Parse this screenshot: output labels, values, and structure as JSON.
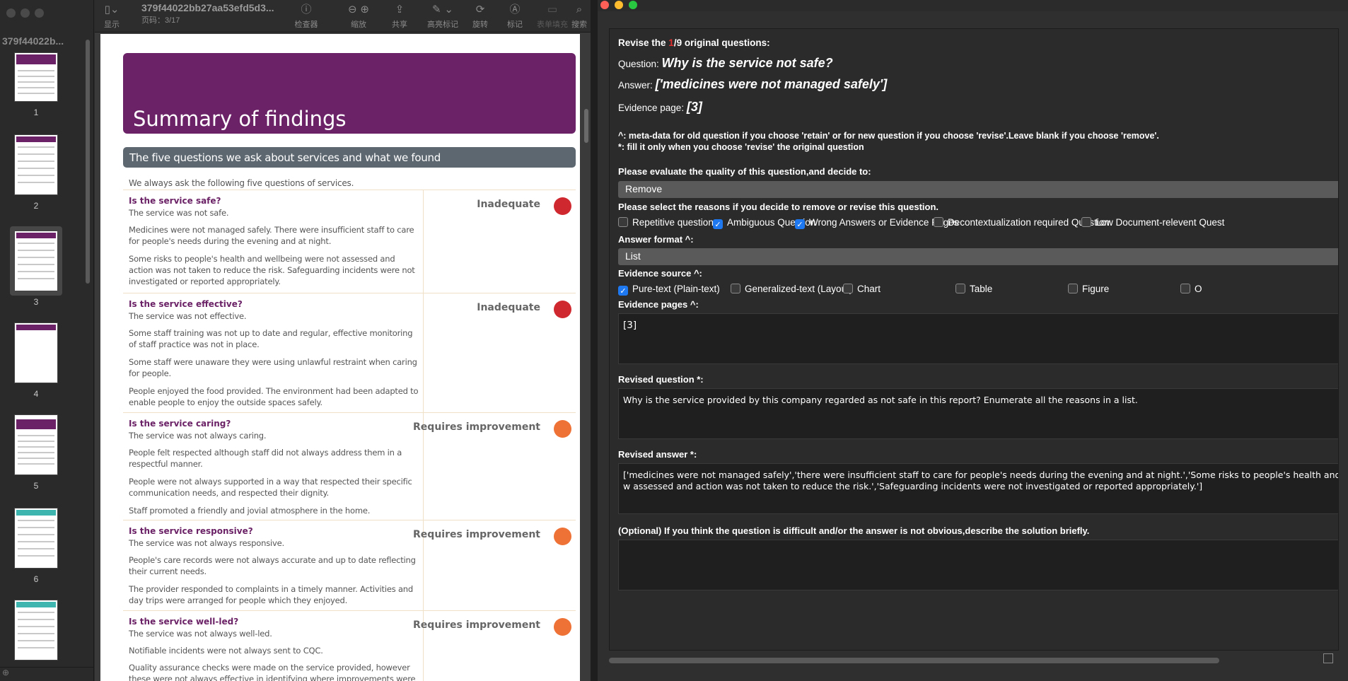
{
  "viewer": {
    "doc_title": "379f44022bb27aa53efd5d3...",
    "page_indicator": "页码：3/17",
    "sidebar_name": "379f44022b...",
    "toolbar": {
      "display": "显示",
      "inspector": "检查器",
      "zoom": "缩放",
      "share": "共享",
      "highlight": "高亮标记",
      "rotate": "旋转",
      "markup": "标记",
      "form_fill": "表单填充",
      "search": "搜索"
    },
    "thumbnails": [
      "1",
      "2",
      "3",
      "4",
      "5",
      "6"
    ],
    "selected_page": "3"
  },
  "pdf": {
    "banner_title": "Summary of findings",
    "section_bar": "The five questions we ask about services and what we found",
    "intro": "We always ask the following five questions of services.",
    "sections": [
      {
        "question": "Is the service safe?",
        "rating": "Inadequate",
        "rating_color": "#d0282f",
        "paras": [
          "The service was not safe.",
          "Medicines were not managed safely. There were insufficient staff to care for people's needs during the evening and at night.",
          "Some risks to people's health and wellbeing were not assessed and action was not taken to reduce the risk. Safeguarding incidents were not investigated or reported appropriately."
        ]
      },
      {
        "question": "Is the service effective?",
        "rating": "Inadequate",
        "rating_color": "#d0282f",
        "paras": [
          "The service was not effective.",
          "Some staff training was not up to date and regular, effective monitoring of staff practice was not in place.",
          "Some staff were unaware they were using unlawful restraint when caring for people.",
          "People enjoyed the food provided. The environment had been adapted to enable people to enjoy the outside spaces safely."
        ]
      },
      {
        "question": "Is the service caring?",
        "rating": "Requires improvement",
        "rating_color": "#ee7236",
        "paras": [
          "The service was not always caring.",
          "People felt respected although staff did not always address them in a respectful manner.",
          "People were not always supported in a way that respected their specific communication needs, and respected their dignity.",
          "Staff promoted a friendly and jovial atmosphere in the home."
        ]
      },
      {
        "question": "Is the service responsive?",
        "rating": "Requires improvement",
        "rating_color": "#ee7236",
        "paras": [
          "The service was not always responsive.",
          "People's care records were not always accurate and up to date reflecting their current needs.",
          "The provider responded to complaints in a timely manner. Activities and day trips were arranged for people which they enjoyed."
        ]
      },
      {
        "question": "Is the service well-led?",
        "rating": "Requires improvement",
        "rating_color": "#ee7236",
        "paras": [
          "The service was not always well-led.",
          "Notifiable incidents were not always sent to CQC.",
          "Quality assurance checks were made on the service provided, however these were not always effective in identifying where improvements were required."
        ]
      }
    ]
  },
  "form": {
    "revise_prefix": "Revise the ",
    "revise_index": "1",
    "revise_suffix": "/9 original questions:",
    "question_label": "Question: ",
    "question_value": "Why is the service not safe?",
    "answer_label": "Answer: ",
    "answer_value": "['medicines were not managed safely']",
    "evidence_label": "Evidence page: ",
    "evidence_value": "[3]",
    "note1": "^: meta-data for old question if you choose 'retain' or for new question if you choose 'revise'.Leave blank if you choose 'remove'.",
    "note2": "*: fill it only when you choose 'revise' the original question",
    "evaluate_label": "Please evaluate the quality of this question,and decide to:",
    "decision": "Remove",
    "reasons_label": "Please select the reasons if you decide to remove or revise this question.",
    "reasons": [
      {
        "label": "Repetitive question",
        "checked": false
      },
      {
        "label": "Ambiguous Question",
        "checked": true
      },
      {
        "label": "Wrong Answers or Evidence Pages",
        "checked": true
      },
      {
        "label": "Decontextualization required Question",
        "checked": false
      },
      {
        "label": "Low Document-relevent Quest",
        "checked": false
      }
    ],
    "answer_format_label": "Answer format ^:",
    "answer_format": "List",
    "evidence_source_label": "Evidence source ^:",
    "sources": [
      {
        "label": "Pure-text (Plain-text)",
        "checked": true
      },
      {
        "label": "Generalized-text (Layout)",
        "checked": false
      },
      {
        "label": "Chart",
        "checked": false
      },
      {
        "label": "Table",
        "checked": false
      },
      {
        "label": "Figure",
        "checked": false
      },
      {
        "label": "O",
        "checked": false
      }
    ],
    "evidence_pages_label": "Evidence pages ^:",
    "evidence_pages_value": "[3]",
    "revised_question_label": "Revised question *:",
    "revised_question_value": "Why is the service provided by this company regarded as not safe in this report? Enumerate all the reasons in a list.",
    "revised_answer_label": "Revised answer *:",
    "revised_answer_value": "['medicines were not managed safely','there were insufficient staff to care for people's needs during the evening and at night.','Some risks to people's health and w assessed and action was not taken to reduce the risk.','Safeguarding incidents were not investigated or reported appropriately.']",
    "optional_label": "(Optional) If you think the question is difficult and/or the answer is not obvious,describe the solution briefly.",
    "optional_value": ""
  }
}
